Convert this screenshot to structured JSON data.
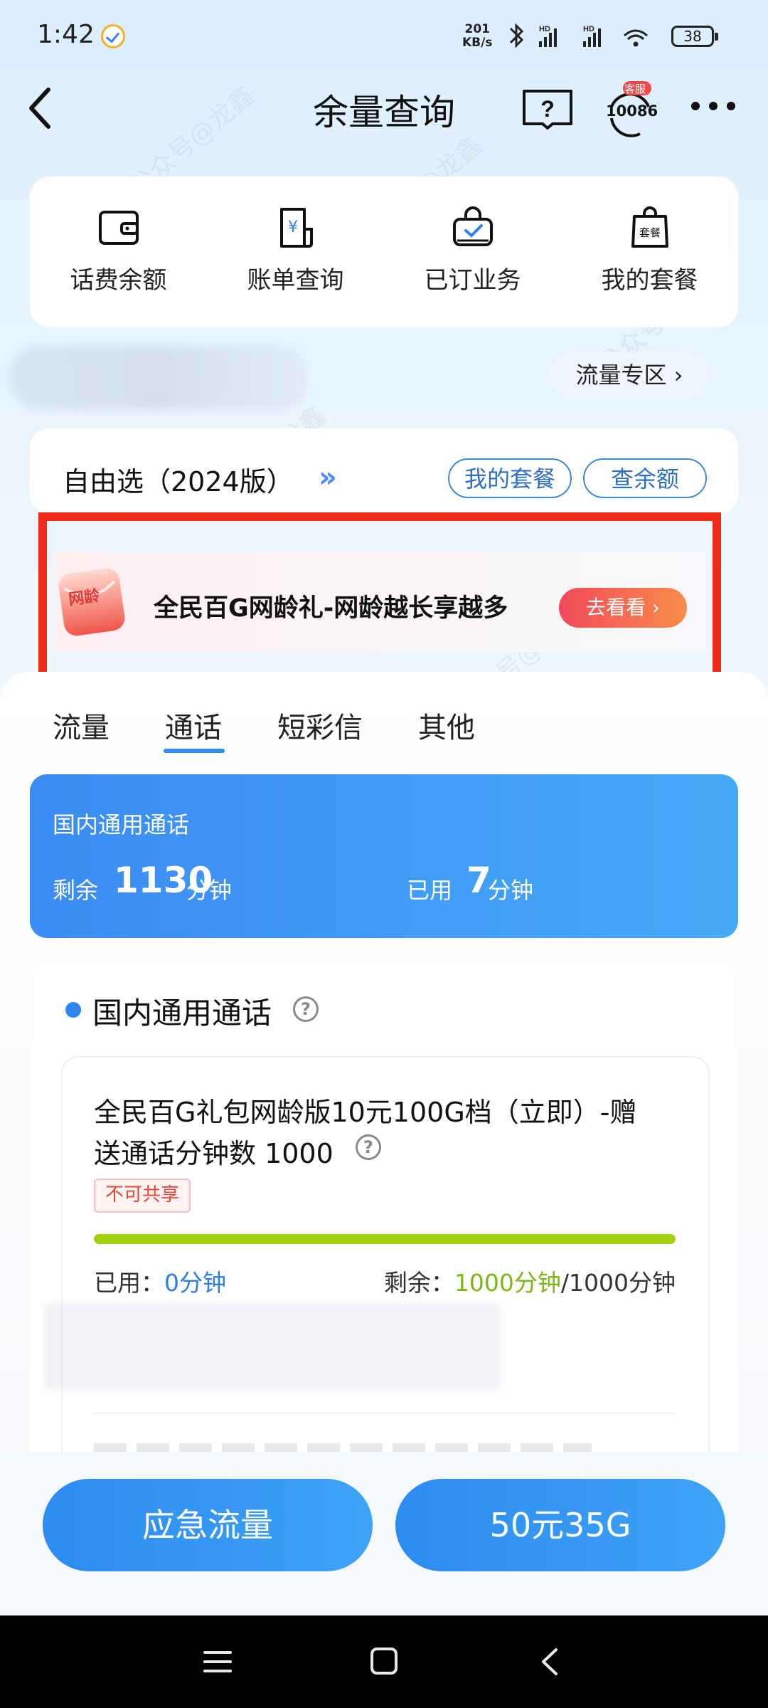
{
  "status_bar": {
    "time": "1:42",
    "speed_value": "201",
    "speed_unit": "KB/s",
    "battery": "38"
  },
  "nav": {
    "title": "余量查询",
    "service_badge": "客服",
    "service_number": "10086"
  },
  "quick_menu": [
    {
      "label": "话费余额",
      "icon": "wallet-icon"
    },
    {
      "label": "账单查询",
      "icon": "bill-icon"
    },
    {
      "label": "已订业务",
      "icon": "bag-check-icon"
    },
    {
      "label": "我的套餐",
      "icon": "package-bag-icon"
    }
  ],
  "quick_menu_package_icon_text": "套餐",
  "account": {
    "zone_button": "流量专区 ›"
  },
  "plan": {
    "name": "自由选（2024版）",
    "arrow": "»",
    "my_package_button": "我的套餐",
    "check_balance_button": "查余额"
  },
  "promo": {
    "gift_text": "网龄",
    "text": "全民百G网龄礼-网龄越长享越多",
    "button": "去看看 ›"
  },
  "tabs": [
    {
      "label": "流量",
      "active": false
    },
    {
      "label": "通话",
      "active": true
    },
    {
      "label": "短彩信",
      "active": false
    },
    {
      "label": "其他",
      "active": false
    }
  ],
  "summary": {
    "title": "国内通用通话",
    "remaining_label": "剩余",
    "remaining_value": "1130",
    "remaining_unit": "分钟",
    "used_label": "已用",
    "used_value": "7",
    "used_unit": "分钟"
  },
  "detail": {
    "section_title": "国内通用通话",
    "help_glyph": "?",
    "package_line1": "全民百G礼包网龄版10元100G档（立即）-赠",
    "package_line2": "送通话分钟数 1000",
    "tag": "不可共享",
    "progress_remaining_fraction": 1.0,
    "used_label": "已用：",
    "used_value": "0分钟",
    "remaining_label": "剩余：",
    "remaining_value": "1000分钟",
    "total": "/1000分钟"
  },
  "bottom": {
    "left_button": "应急流量",
    "right_button": "50元35G"
  },
  "watermark": "公众号@龙鑫",
  "colors": {
    "accent_blue": "#2f8cf0",
    "promo_red": "#ef2b18",
    "progress_green": "#9fd10f",
    "remaining_green": "#7cb518",
    "used_blue": "#2d7ee0"
  }
}
